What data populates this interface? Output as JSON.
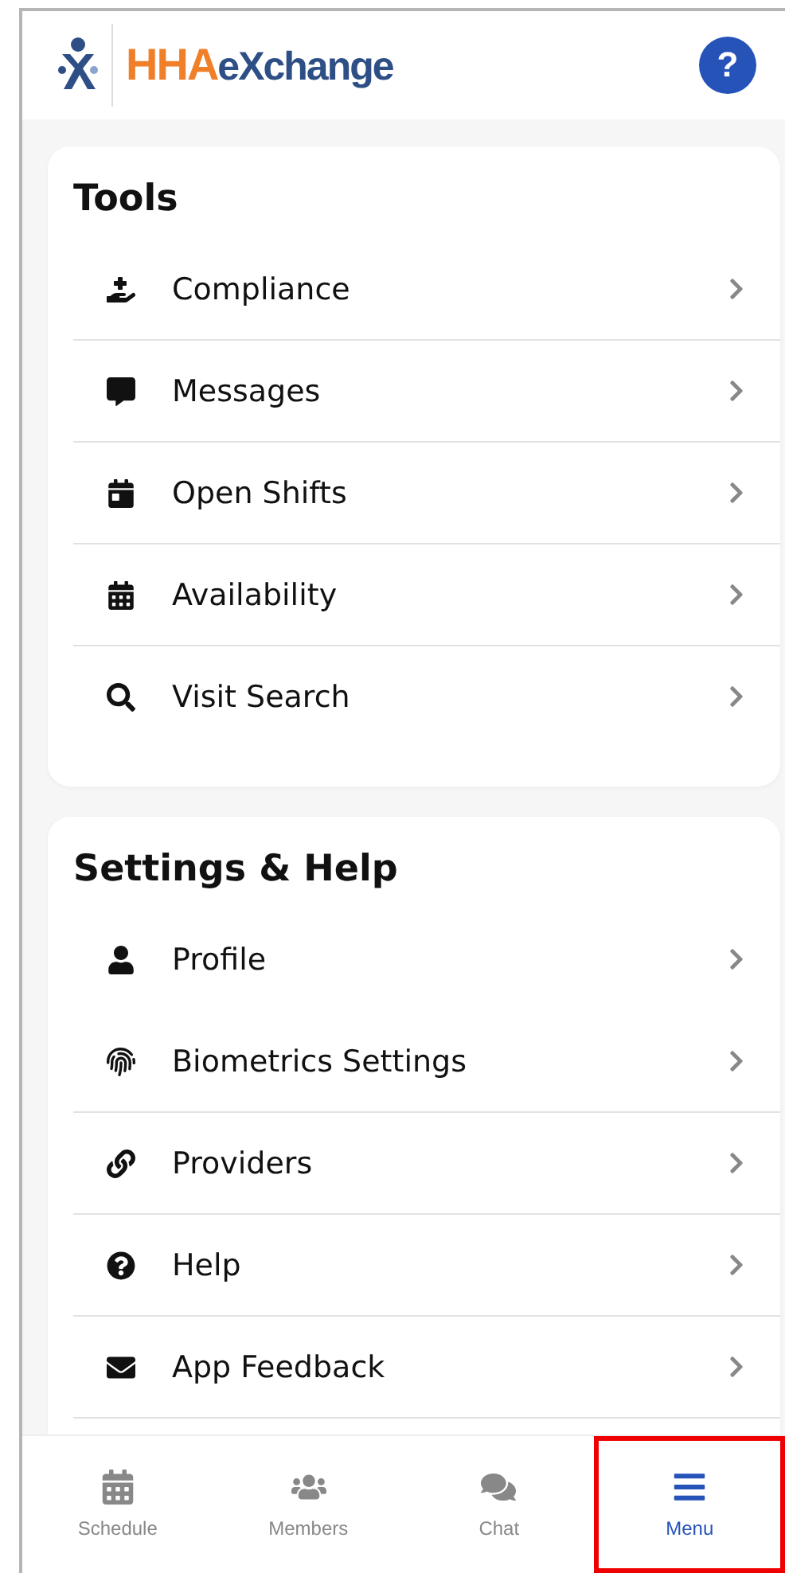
{
  "header": {
    "logo_mark": "HHA",
    "logo_name": "eXchange",
    "help_button": "?"
  },
  "sections": [
    {
      "title": "Tools",
      "items": [
        {
          "label": "Compliance",
          "divider": true
        },
        {
          "label": "Messages",
          "divider": true
        },
        {
          "label": "Open Shifts",
          "divider": true
        },
        {
          "label": "Availability",
          "divider": true
        },
        {
          "label": "Visit Search",
          "divider": false
        }
      ]
    },
    {
      "title": "Settings & Help",
      "items": [
        {
          "label": "Profile",
          "divider": false
        },
        {
          "label": "Biometrics Settings",
          "divider": true
        },
        {
          "label": "Providers",
          "divider": true
        },
        {
          "label": "Help",
          "divider": true
        },
        {
          "label": "App Feedback",
          "divider": true
        }
      ]
    }
  ],
  "bottom_nav": [
    {
      "label": "Schedule",
      "selected": false,
      "highlighted": false
    },
    {
      "label": "Members",
      "selected": false,
      "highlighted": false
    },
    {
      "label": "Chat",
      "selected": false,
      "highlighted": false
    },
    {
      "label": "Menu",
      "selected": true,
      "highlighted": true
    }
  ]
}
